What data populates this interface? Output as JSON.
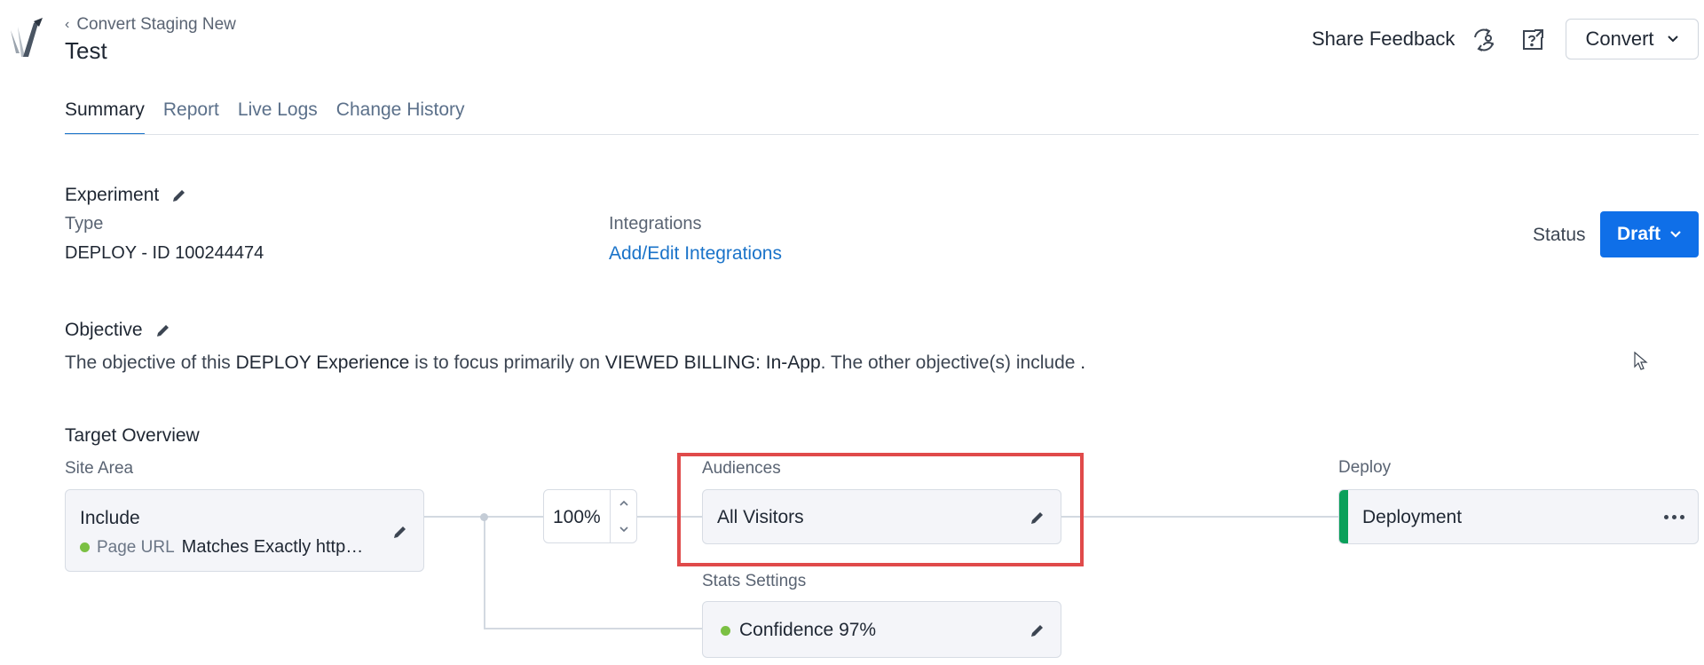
{
  "header": {
    "breadcrumb": "Convert Staging New",
    "title": "Test",
    "share_feedback": "Share Feedback",
    "convert_label": "Convert"
  },
  "tabs": [
    {
      "label": "Summary",
      "active": true
    },
    {
      "label": "Report",
      "active": false
    },
    {
      "label": "Live Logs",
      "active": false
    },
    {
      "label": "Change History",
      "active": false
    }
  ],
  "experiment": {
    "title": "Experiment",
    "type_label": "Type",
    "type_value": "DEPLOY - ID 100244474",
    "integrations_label": "Integrations",
    "integrations_link": "Add/Edit Integrations",
    "status_label": "Status",
    "status_value": "Draft"
  },
  "objective": {
    "title": "Objective",
    "text_1": "The objective of this ",
    "bold_1": "DEPLOY Experience",
    "text_2": " is to focus primarily on ",
    "bold_2": "VIEWED BILLING: In-App",
    "text_3": ". The other objective(s) include ",
    "bold_3": "."
  },
  "target": {
    "title": "Target Overview",
    "site_area_label": "Site Area",
    "include_title": "Include",
    "rule_key": "Page URL",
    "rule_value": "Matches Exactly http…",
    "percent": "100%",
    "audiences_label": "Audiences",
    "audience_value": "All Visitors",
    "stats_label": "Stats Settings",
    "stats_value": "Confidence 97%",
    "deploy_label": "Deploy",
    "deploy_value": "Deployment"
  },
  "colors": {
    "accent": "#0f6fe8",
    "link": "#1a73c9",
    "highlight": "#e04a4a",
    "success": "#0aa05a",
    "dot": "#7bc043"
  }
}
